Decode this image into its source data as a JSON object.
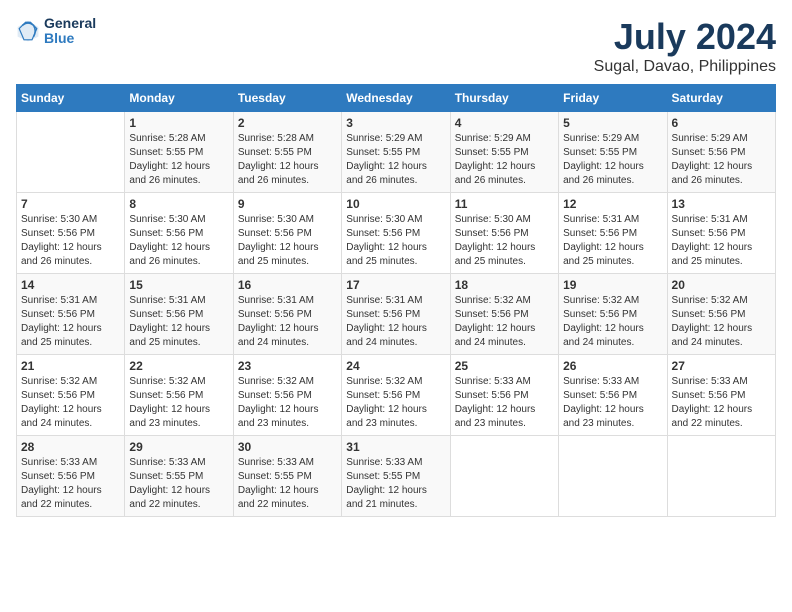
{
  "header": {
    "logo": {
      "line1": "General",
      "line2": "Blue"
    },
    "title": "July 2024",
    "subtitle": "Sugal, Davao, Philippines"
  },
  "days_of_week": [
    "Sunday",
    "Monday",
    "Tuesday",
    "Wednesday",
    "Thursday",
    "Friday",
    "Saturday"
  ],
  "weeks": [
    [
      {
        "day": "",
        "info": ""
      },
      {
        "day": "1",
        "info": "Sunrise: 5:28 AM\nSunset: 5:55 PM\nDaylight: 12 hours\nand 26 minutes."
      },
      {
        "day": "2",
        "info": "Sunrise: 5:28 AM\nSunset: 5:55 PM\nDaylight: 12 hours\nand 26 minutes."
      },
      {
        "day": "3",
        "info": "Sunrise: 5:29 AM\nSunset: 5:55 PM\nDaylight: 12 hours\nand 26 minutes."
      },
      {
        "day": "4",
        "info": "Sunrise: 5:29 AM\nSunset: 5:55 PM\nDaylight: 12 hours\nand 26 minutes."
      },
      {
        "day": "5",
        "info": "Sunrise: 5:29 AM\nSunset: 5:55 PM\nDaylight: 12 hours\nand 26 minutes."
      },
      {
        "day": "6",
        "info": "Sunrise: 5:29 AM\nSunset: 5:56 PM\nDaylight: 12 hours\nand 26 minutes."
      }
    ],
    [
      {
        "day": "7",
        "info": ""
      },
      {
        "day": "8",
        "info": "Sunrise: 5:30 AM\nSunset: 5:56 PM\nDaylight: 12 hours\nand 26 minutes."
      },
      {
        "day": "9",
        "info": "Sunrise: 5:30 AM\nSunset: 5:56 PM\nDaylight: 12 hours\nand 25 minutes."
      },
      {
        "day": "10",
        "info": "Sunrise: 5:30 AM\nSunset: 5:56 PM\nDaylight: 12 hours\nand 25 minutes."
      },
      {
        "day": "11",
        "info": "Sunrise: 5:30 AM\nSunset: 5:56 PM\nDaylight: 12 hours\nand 25 minutes."
      },
      {
        "day": "12",
        "info": "Sunrise: 5:31 AM\nSunset: 5:56 PM\nDaylight: 12 hours\nand 25 minutes."
      },
      {
        "day": "13",
        "info": "Sunrise: 5:31 AM\nSunset: 5:56 PM\nDaylight: 12 hours\nand 25 minutes."
      }
    ],
    [
      {
        "day": "14",
        "info": ""
      },
      {
        "day": "15",
        "info": "Sunrise: 5:31 AM\nSunset: 5:56 PM\nDaylight: 12 hours\nand 25 minutes."
      },
      {
        "day": "16",
        "info": "Sunrise: 5:31 AM\nSunset: 5:56 PM\nDaylight: 12 hours\nand 24 minutes."
      },
      {
        "day": "17",
        "info": "Sunrise: 5:31 AM\nSunset: 5:56 PM\nDaylight: 12 hours\nand 24 minutes."
      },
      {
        "day": "18",
        "info": "Sunrise: 5:32 AM\nSunset: 5:56 PM\nDaylight: 12 hours\nand 24 minutes."
      },
      {
        "day": "19",
        "info": "Sunrise: 5:32 AM\nSunset: 5:56 PM\nDaylight: 12 hours\nand 24 minutes."
      },
      {
        "day": "20",
        "info": "Sunrise: 5:32 AM\nSunset: 5:56 PM\nDaylight: 12 hours\nand 24 minutes."
      }
    ],
    [
      {
        "day": "21",
        "info": ""
      },
      {
        "day": "22",
        "info": "Sunrise: 5:32 AM\nSunset: 5:56 PM\nDaylight: 12 hours\nand 23 minutes."
      },
      {
        "day": "23",
        "info": "Sunrise: 5:32 AM\nSunset: 5:56 PM\nDaylight: 12 hours\nand 23 minutes."
      },
      {
        "day": "24",
        "info": "Sunrise: 5:32 AM\nSunset: 5:56 PM\nDaylight: 12 hours\nand 23 minutes."
      },
      {
        "day": "25",
        "info": "Sunrise: 5:33 AM\nSunset: 5:56 PM\nDaylight: 12 hours\nand 23 minutes."
      },
      {
        "day": "26",
        "info": "Sunrise: 5:33 AM\nSunset: 5:56 PM\nDaylight: 12 hours\nand 23 minutes."
      },
      {
        "day": "27",
        "info": "Sunrise: 5:33 AM\nSunset: 5:56 PM\nDaylight: 12 hours\nand 22 minutes."
      }
    ],
    [
      {
        "day": "28",
        "info": "Sunrise: 5:33 AM\nSunset: 5:56 PM\nDaylight: 12 hours\nand 22 minutes."
      },
      {
        "day": "29",
        "info": "Sunrise: 5:33 AM\nSunset: 5:55 PM\nDaylight: 12 hours\nand 22 minutes."
      },
      {
        "day": "30",
        "info": "Sunrise: 5:33 AM\nSunset: 5:55 PM\nDaylight: 12 hours\nand 22 minutes."
      },
      {
        "day": "31",
        "info": "Sunrise: 5:33 AM\nSunset: 5:55 PM\nDaylight: 12 hours\nand 21 minutes."
      },
      {
        "day": "",
        "info": ""
      },
      {
        "day": "",
        "info": ""
      },
      {
        "day": "",
        "info": ""
      }
    ]
  ],
  "week7_sunday": {
    "info": "Sunrise: 5:30 AM\nSunset: 5:56 PM\nDaylight: 12 hours\nand 26 minutes."
  },
  "week14_sunday": {
    "info": "Sunrise: 5:31 AM\nSunset: 5:56 PM\nDaylight: 12 hours\nand 25 minutes."
  },
  "week21_sunday": {
    "info": "Sunrise: 5:32 AM\nSunset: 5:56 PM\nDaylight: 12 hours\nand 24 minutes."
  },
  "week21_sunday2": {
    "info": "Sunrise: 5:32 AM\nSunset: 5:56 PM\nDaylight: 12 hours\nand 24 minutes."
  }
}
